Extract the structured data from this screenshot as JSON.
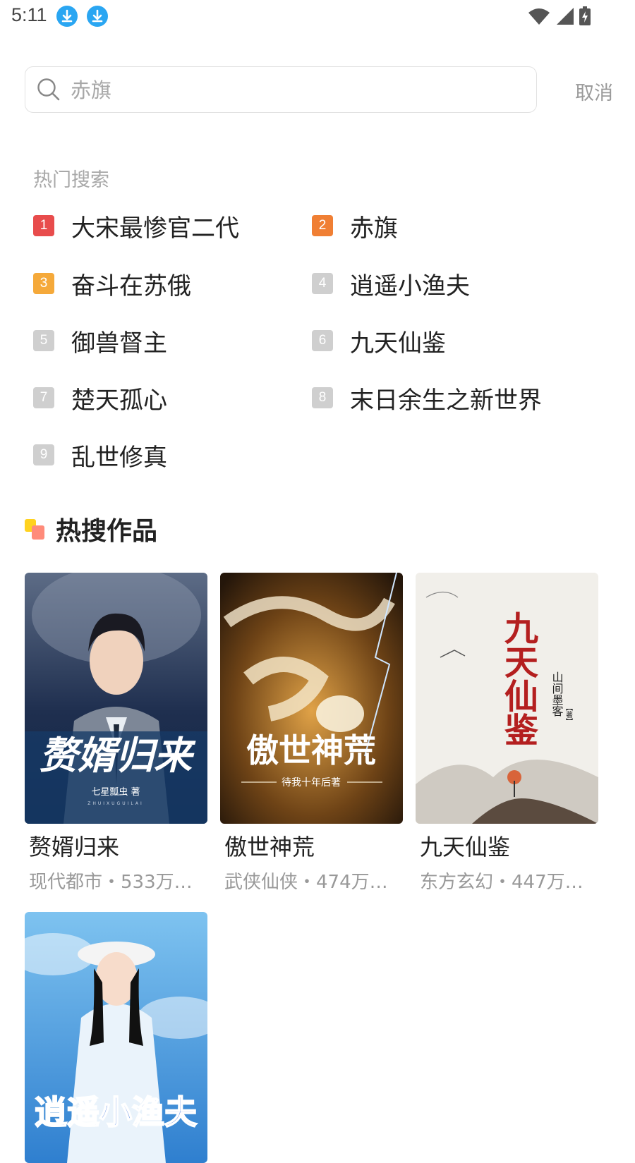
{
  "status_bar": {
    "time": "5:11"
  },
  "search": {
    "placeholder": "赤旗",
    "value": "",
    "cancel_label": "取消"
  },
  "hot_search": {
    "title": "热门搜索",
    "items": [
      {
        "rank": "1",
        "label": "大宋最惨官二代",
        "color": "#e84c4c"
      },
      {
        "rank": "2",
        "label": "赤旗",
        "color": "#f07f34"
      },
      {
        "rank": "3",
        "label": "奋斗在苏俄",
        "color": "#f5a93a"
      },
      {
        "rank": "4",
        "label": "逍遥小渔夫",
        "color": "#cfcfcf"
      },
      {
        "rank": "5",
        "label": "御兽督主",
        "color": "#cfcfcf"
      },
      {
        "rank": "6",
        "label": "九天仙鉴",
        "color": "#cfcfcf"
      },
      {
        "rank": "7",
        "label": "楚天孤心",
        "color": "#cfcfcf"
      },
      {
        "rank": "8",
        "label": "末日余生之新世界",
        "color": "#cfcfcf"
      },
      {
        "rank": "9",
        "label": "乱世修真",
        "color": "#cfcfcf"
      }
    ]
  },
  "hot_works": {
    "title": "热搜作品",
    "books": [
      {
        "title": "赘婿归来",
        "meta": "现代都市・533万…",
        "cover_title": "赘婿归来",
        "cover_author": "七星瓢虫 著",
        "cover_pinyin": "ZHUIXUGUILAI"
      },
      {
        "title": "傲世神荒",
        "meta": "武侠仙侠・474万…",
        "cover_title": "傲世神荒",
        "cover_author": "待我十年后著"
      },
      {
        "title": "九天仙鉴",
        "meta": "东方玄幻・447万…",
        "cover_title": "九天仙鉴",
        "cover_author": "山间墨客",
        "cover_author_tag": "【著】"
      },
      {
        "title": "逍遥小渔夫",
        "meta": "",
        "cover_title": "逍遥小渔夫"
      }
    ]
  }
}
